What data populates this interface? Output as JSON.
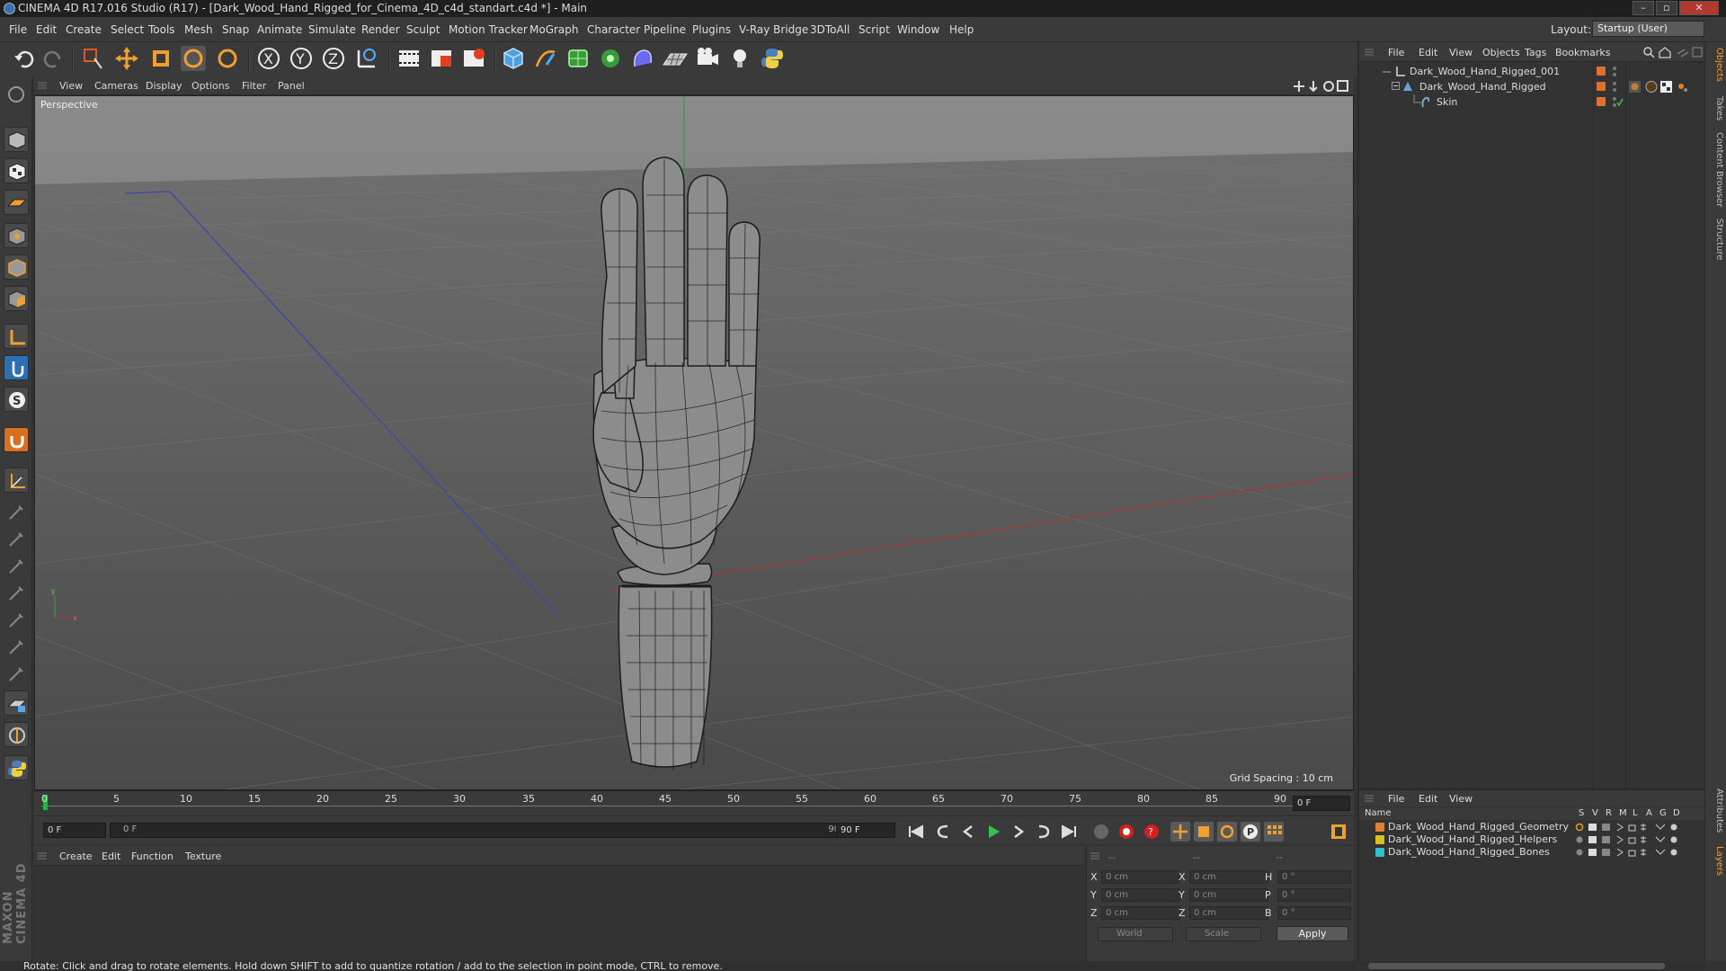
{
  "window": {
    "title": "CINEMA 4D R17.016 Studio (R17) - [Dark_Wood_Hand_Rigged_for_Cinema_4D_c4d_standart.c4d *] - Main"
  },
  "menu": [
    "File",
    "Edit",
    "Create",
    "Select",
    "Tools",
    "Mesh",
    "Snap",
    "Animate",
    "Simulate",
    "Render",
    "Sculpt",
    "Motion Tracker",
    "MoGraph",
    "Character",
    "Pipeline",
    "Plugins",
    "V-Ray Bridge",
    "3DToAll",
    "Script",
    "Window",
    "Help"
  ],
  "layout": {
    "label": "Layout:",
    "value": "Startup (User)"
  },
  "viewport": {
    "menu": [
      "View",
      "Cameras",
      "Display",
      "Options",
      "Filter",
      "Panel"
    ],
    "name": "Perspective",
    "grid_spacing": "Grid Spacing : 10 cm"
  },
  "timeline": {
    "ticks": [
      "0",
      "5",
      "10",
      "15",
      "20",
      "25",
      "30",
      "35",
      "40",
      "45",
      "50",
      "55",
      "60",
      "65",
      "70",
      "75",
      "80",
      "85",
      "90"
    ],
    "current_frame": "0 F",
    "start_field": "0 F",
    "range_start": "0 F",
    "range_end": "90 F",
    "end_field": "90 F"
  },
  "material": {
    "menu": [
      "Create",
      "Edit",
      "Function",
      "Texture"
    ]
  },
  "coordinates": {
    "header": [
      "--",
      "--",
      "--"
    ],
    "rows": [
      {
        "a": "X",
        "av": "0 cm",
        "b": "X",
        "bv": "0 cm",
        "c": "H",
        "cv": "0 °"
      },
      {
        "a": "Y",
        "av": "0 cm",
        "b": "Y",
        "bv": "0 cm",
        "c": "P",
        "cv": "0 °"
      },
      {
        "a": "Z",
        "av": "0 cm",
        "b": "Z",
        "bv": "0 cm",
        "c": "B",
        "cv": "0 °"
      }
    ],
    "mode1": "World",
    "mode2": "Scale",
    "apply": "Apply"
  },
  "status": "Rotate: Click and drag to rotate elements. Hold down SHIFT to add to quantize rotation / add to the selection in point mode, CTRL to remove.",
  "object_manager": {
    "menu": [
      "File",
      "Edit",
      "View",
      "Objects",
      "Tags",
      "Bookmarks"
    ],
    "objects": [
      {
        "name": "Dark_Wood_Hand_Rigged_001",
        "color": "#e0702a"
      },
      {
        "name": "Dark_Wood_Hand_Rigged",
        "color": "#e0702a"
      },
      {
        "name": "Skin",
        "color": "#e0702a"
      }
    ]
  },
  "layer_manager": {
    "menu": [
      "File",
      "Edit",
      "View"
    ],
    "header_name": "Name",
    "header_cols": [
      "S",
      "V",
      "R",
      "M",
      "L",
      "A",
      "G",
      "D"
    ],
    "layers": [
      {
        "name": "Dark_Wood_Hand_Rigged_Geometry",
        "color": "#e08030"
      },
      {
        "name": "Dark_Wood_Hand_Rigged_Helpers",
        "color": "#d8c020"
      },
      {
        "name": "Dark_Wood_Hand_Rigged_Bones",
        "color": "#30c0d0"
      }
    ]
  },
  "right_tabs": [
    "Objects",
    "Takes",
    "Content Browser",
    "Structure",
    "Attributes",
    "Layers"
  ],
  "brand": "MAXON CINEMA 4D"
}
